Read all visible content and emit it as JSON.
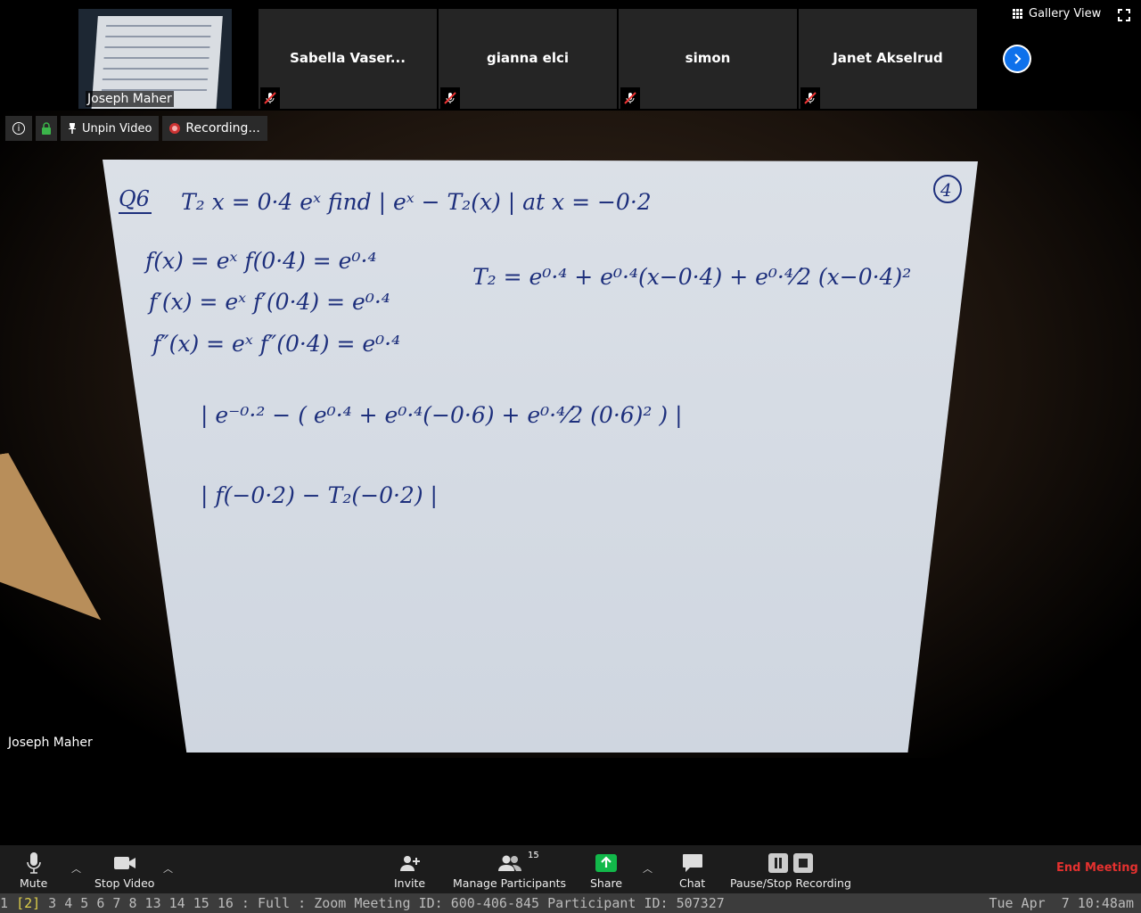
{
  "gallery": {
    "self": {
      "name": "Joseph Maher"
    },
    "participants": [
      {
        "name": "Sabella Vaser..."
      },
      {
        "name": "gianna elci"
      },
      {
        "name": "simon"
      },
      {
        "name": "Janet Akselrud"
      }
    ],
    "view_label": "Gallery View"
  },
  "video_toolbar": {
    "unpin_label": "Unpin Video",
    "recording_label": "Recording..."
  },
  "main_video": {
    "speaker_name": "Joseph Maher",
    "whiteboard": {
      "q_label": "Q6",
      "question_number": "4",
      "lines": [
        "T₂   x = 0·4    eˣ    find  | eˣ − T₂(x) |   at  x = −0·2",
        "f(x) = eˣ     f(0·4) = e⁰·⁴",
        "f′(x) = eˣ    f′(0·4) = e⁰·⁴",
        "f″(x) = eˣ    f″(0·4) = e⁰·⁴",
        "T₂ =  e⁰·⁴ + e⁰·⁴(x−0·4) + e⁰·⁴⁄2 (x−0·4)²",
        "| e⁻⁰·² − ( e⁰·⁴ + e⁰·⁴(−0·6) + e⁰·⁴⁄2 (0·6)² ) |",
        "| f(−0·2)  −   T₂(−0·2) |"
      ]
    }
  },
  "controls": {
    "mute": "Mute",
    "stop_video": "Stop Video",
    "invite": "Invite",
    "manage_participants": "Manage Participants",
    "participant_count": "15",
    "share": "Share",
    "chat": "Chat",
    "pause_stop_recording": "Pause/Stop Recording",
    "end_meeting": "End Meeting"
  },
  "statusbar": {
    "ws_before": "1 ",
    "ws_current": "[2]",
    "ws_after": " 3 4 5 6 7 8 13 14 15 16 : Full : Zoom Meeting ID: 600-406-845 Participant ID: 507327",
    "clock": "Tue Apr  7 10:48am"
  },
  "colors": {
    "zoom_blue": "#0e71eb",
    "share_green": "#12b84a",
    "end_red": "#e5312f",
    "ink": "#1d2f7c"
  }
}
